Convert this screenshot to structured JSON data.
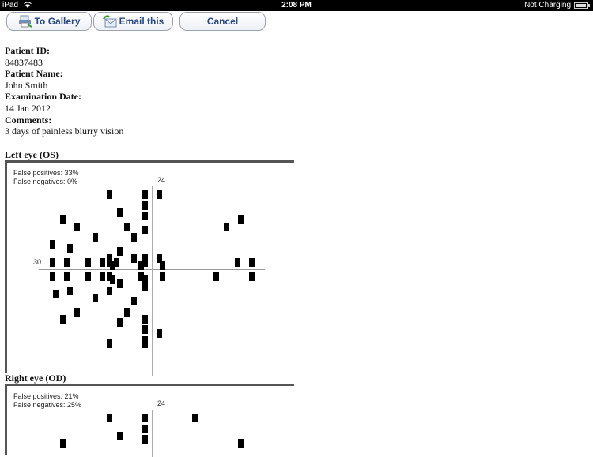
{
  "statusbar": {
    "device": "iPad",
    "time": "2:08 PM",
    "battery_status": "Not Charging"
  },
  "toolbar": {
    "gallery_label": "To Gallery",
    "email_label": "Email this",
    "cancel_label": "Cancel"
  },
  "patient": {
    "id_label": "Patient ID:",
    "id": "84837483",
    "name_label": "Patient Name:",
    "name": "John Smith",
    "date_label": "Examination Date:",
    "date": "14 Jan 2012",
    "comments_label": "Comments:",
    "comments": "3 days of painless blurry vision"
  },
  "chart_data": [
    {
      "type": "scatter",
      "title": "Left eye (OS)",
      "annotations": [
        "False positives: 33%",
        "False negatives: 0%"
      ],
      "axis_labels": {
        "vertical_top": "24",
        "horizontal_left": "30"
      },
      "units": "degrees",
      "points": [
        [
          -12,
          21
        ],
        [
          -2,
          21
        ],
        [
          2,
          21
        ],
        [
          -2,
          18
        ],
        [
          -9,
          16
        ],
        [
          -2,
          15
        ],
        [
          -25,
          14
        ],
        [
          -21,
          12
        ],
        [
          -7,
          12
        ],
        [
          -2,
          11
        ],
        [
          21,
          12
        ],
        [
          25,
          14
        ],
        [
          -5,
          9
        ],
        [
          -16,
          9
        ],
        [
          -28,
          7
        ],
        [
          -23,
          6
        ],
        [
          -9,
          5
        ],
        [
          -12,
          3
        ],
        [
          -2,
          3
        ],
        [
          2,
          3
        ],
        [
          -11,
          1
        ],
        [
          -5,
          3
        ],
        [
          -28,
          2
        ],
        [
          -24,
          2
        ],
        [
          -18,
          2
        ],
        [
          -14,
          2
        ],
        [
          -12,
          2
        ],
        [
          -10,
          2
        ],
        [
          -3,
          1
        ],
        [
          -2,
          2
        ],
        [
          3,
          1
        ],
        [
          24,
          2
        ],
        [
          28,
          2
        ],
        [
          -28,
          -2
        ],
        [
          -24,
          -2
        ],
        [
          -18,
          -2
        ],
        [
          -14,
          -2
        ],
        [
          -12,
          -2
        ],
        [
          -11,
          -3
        ],
        [
          -3,
          -2
        ],
        [
          -2,
          -3
        ],
        [
          3,
          -2
        ],
        [
          18,
          -2
        ],
        [
          28,
          -2
        ],
        [
          -2,
          -5
        ],
        [
          -9,
          -4
        ],
        [
          -23,
          -6
        ],
        [
          -16,
          -8
        ],
        [
          -27,
          -7
        ],
        [
          -12,
          -6
        ],
        [
          -5,
          -9
        ],
        [
          -21,
          -12
        ],
        [
          -25,
          -14
        ],
        [
          -7,
          -12
        ],
        [
          -9,
          -15
        ],
        [
          -2,
          -14
        ],
        [
          -2,
          -17
        ],
        [
          -2,
          -20
        ],
        [
          2,
          -18
        ],
        [
          -12,
          -21
        ],
        [
          -2,
          -21
        ]
      ]
    },
    {
      "type": "scatter",
      "title": "Right eye (OD)",
      "annotations": [
        "False positives: 21%",
        "False negatives: 25%"
      ],
      "axis_labels": {
        "vertical_top": "24"
      },
      "units": "degrees",
      "points": [
        [
          -12,
          21
        ],
        [
          -2,
          21
        ],
        [
          12,
          21
        ],
        [
          -2,
          18
        ],
        [
          -9,
          16
        ],
        [
          -2,
          15
        ],
        [
          -25,
          14
        ],
        [
          25,
          14
        ]
      ]
    }
  ]
}
